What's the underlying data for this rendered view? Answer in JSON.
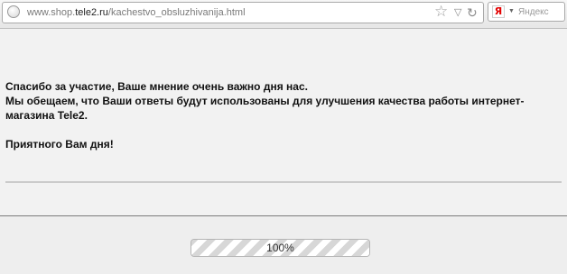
{
  "browser": {
    "url_prefix": "www.shop.",
    "url_host": "tele2.ru",
    "url_path": "/kachestvo_obsluzhivanija.html",
    "search_engine_letter": "Я",
    "search_placeholder": "Яндекс"
  },
  "message": {
    "line1": "Спасибо за участие, Ваше мнение очень важно дня нас.",
    "line2": "Мы обещаем, что Ваши ответы будут использованы для улучшения качества работы интернет-магазина Tele2.",
    "line3": "Приятного Вам дня!"
  },
  "progress": {
    "fraction": 1.0,
    "label": "100%"
  },
  "icons": {
    "site": "site-identity-icon",
    "bookmark": "bookmark-star-icon",
    "history": "history-dropmarker-icon",
    "reload": "reload-icon",
    "engine": "yandex-icon",
    "engine_menu": "engine-dropdown-icon"
  }
}
